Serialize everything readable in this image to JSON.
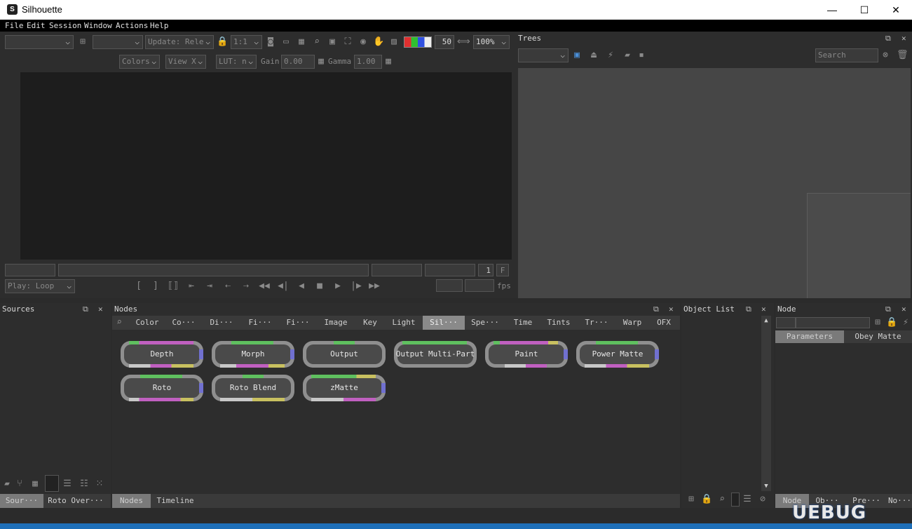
{
  "window": {
    "title": "Silhouette",
    "minimize": "—",
    "maximize": "☐",
    "close": "✕"
  },
  "menu": [
    "File",
    "Edit",
    "Session",
    "Window",
    "Actions",
    "Help"
  ],
  "viewer_toolbar": {
    "update_label": "Update: Rele",
    "ratio": "1:1",
    "frame_value": "50",
    "zoom": "100%",
    "colors_label": "Colors",
    "view_label": "View X",
    "lut_label": "LUT: n",
    "gain_label": "Gain",
    "gain_value": "0.00",
    "gamma_label": "Gamma",
    "gamma_value": "1.00"
  },
  "timeline": {
    "frame": "1",
    "f_label": "F",
    "play_mode": "Play: Loop",
    "fps_label": "fps"
  },
  "trees": {
    "title": "Trees",
    "search_placeholder": "Search"
  },
  "sources": {
    "title": "Sources",
    "tabs": [
      "Sour···",
      "Roto Over···"
    ]
  },
  "nodes_panel": {
    "title": "Nodes",
    "categories": [
      "Color",
      "Co···",
      "Di···",
      "Fi···",
      "Fi···",
      "Image",
      "Key",
      "Light",
      "Sil···",
      "Spe···",
      "Time",
      "Tints",
      "Tr···",
      "Warp",
      "OFX"
    ],
    "active_category": "Sil···",
    "nodes": [
      "Depth",
      "Morph",
      "Output",
      "Output Multi-Part",
      "Paint",
      "Power Matte",
      "Roto",
      "Roto Blend",
      "zMatte"
    ],
    "bottom_tabs": [
      "Nodes",
      "Timeline"
    ]
  },
  "object_list": {
    "title": "Object List"
  },
  "node_panel": {
    "title": "Node",
    "tabs": [
      "Parameters",
      "Obey Matte"
    ],
    "bottom_tabs": [
      "Node",
      "Ob···",
      "Pre···",
      "No···"
    ]
  },
  "watermark": "UEBUG",
  "colors": {
    "accent": "#4a8fd8",
    "green_port": "#5fc05f",
    "magenta_port": "#c060c0",
    "yellow_port": "#c8c060",
    "blue_port": "#7070d0"
  }
}
